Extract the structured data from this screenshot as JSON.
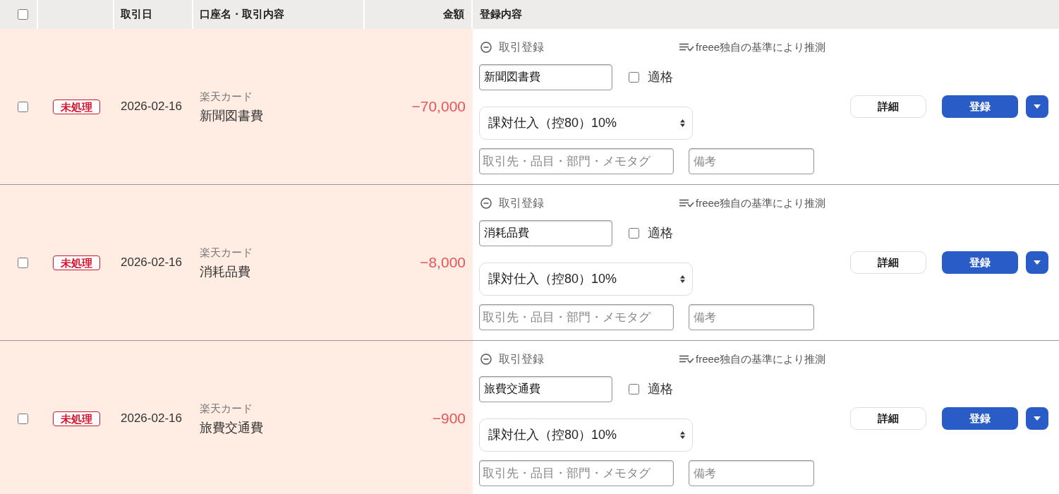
{
  "header": {
    "select_all_checked": false,
    "columns": [
      "取引日",
      "口座名・取引内容",
      "金額",
      "登録内容"
    ]
  },
  "rows": [
    {
      "checked": false,
      "status": "未処理",
      "date": "2026-02-16",
      "account": "楽天カード",
      "description": "新聞図書費",
      "amount": "−70,000",
      "entry": {
        "toggle": "取引登録",
        "inference": "freee独自の基準により推測",
        "account_item": "新聞図書費",
        "qualified": {
          "label": "適格",
          "checked": false
        },
        "tax_category": "課対仕入（控80）10%",
        "tags_placeholder": "取引先・品目・部門・メモタグ",
        "note_placeholder": "備考"
      },
      "buttons": {
        "detail": "詳細",
        "register": "登録"
      }
    },
    {
      "checked": false,
      "status": "未処理",
      "date": "2026-02-16",
      "account": "楽天カード",
      "description": "消耗品費",
      "amount": "−8,000",
      "entry": {
        "toggle": "取引登録",
        "inference": "freee独自の基準により推測",
        "account_item": "消耗品費",
        "qualified": {
          "label": "適格",
          "checked": false
        },
        "tax_category": "課対仕入（控80）10%",
        "tags_placeholder": "取引先・品目・部門・メモタグ",
        "note_placeholder": "備考"
      },
      "buttons": {
        "detail": "詳細",
        "register": "登録"
      }
    },
    {
      "checked": false,
      "status": "未処理",
      "date": "2026-02-16",
      "account": "楽天カード",
      "description": "旅費交通費",
      "amount": "−900",
      "entry": {
        "toggle": "取引登録",
        "inference": "freee独自の基準により推測",
        "account_item": "旅費交通費",
        "qualified": {
          "label": "適格",
          "checked": false
        },
        "tax_category": "課対仕入（控80）10%",
        "tags_placeholder": "取引先・品目・部門・メモタグ",
        "note_placeholder": "備考"
      },
      "buttons": {
        "detail": "詳細",
        "register": "登録"
      }
    }
  ]
}
